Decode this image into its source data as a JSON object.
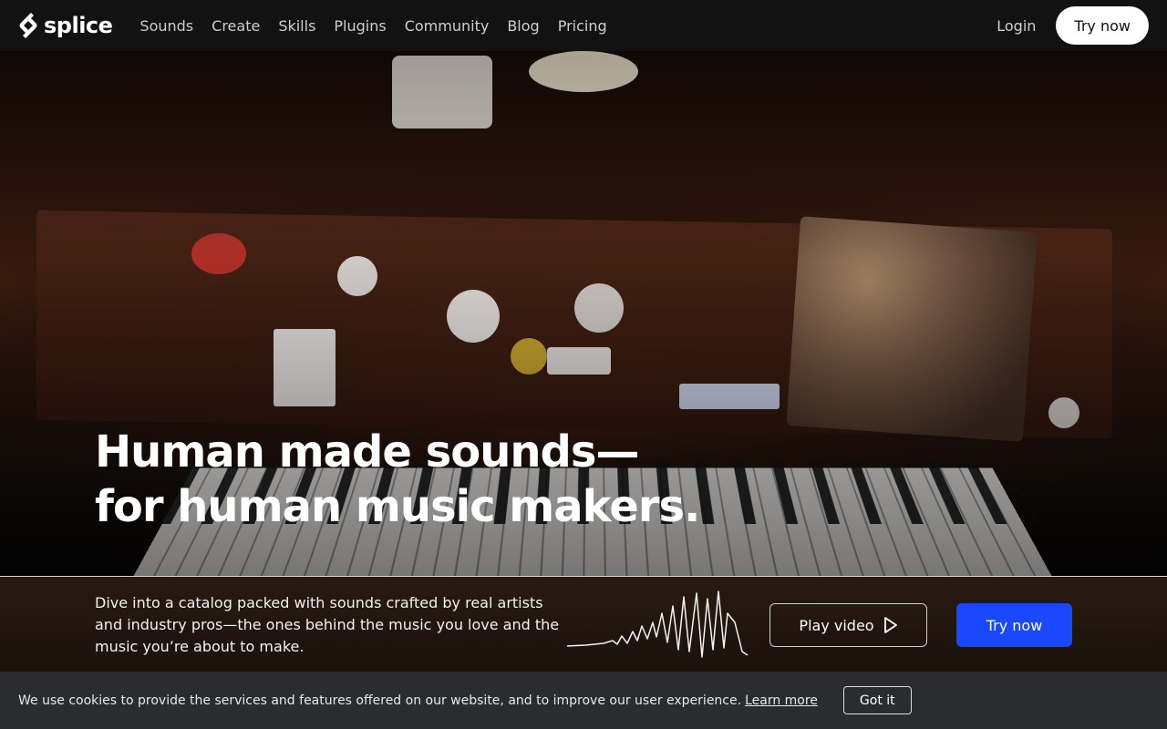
{
  "brand": {
    "name": "splice",
    "logo_icon": "splice-logo-icon"
  },
  "nav": {
    "links": [
      "Sounds",
      "Create",
      "Skills",
      "Plugins",
      "Community",
      "Blog",
      "Pricing"
    ],
    "login": "Login",
    "try_now": "Try now"
  },
  "hero": {
    "headline_line1": "Human made sounds—",
    "headline_line2": "for human music makers."
  },
  "strip": {
    "description": "Dive into a catalog packed with sounds crafted by real artists and industry pros—the ones behind the music you love and the music you’re about to make.",
    "play_video": "Play video",
    "play_icon": "play-icon",
    "try_now": "Try now",
    "accent_color": "#1a48ff"
  },
  "cookie": {
    "text": "We use cookies to provide the services and features offered on our website, and to improve our user experience.",
    "learn_more": "Learn more",
    "got_it": "Got it"
  }
}
